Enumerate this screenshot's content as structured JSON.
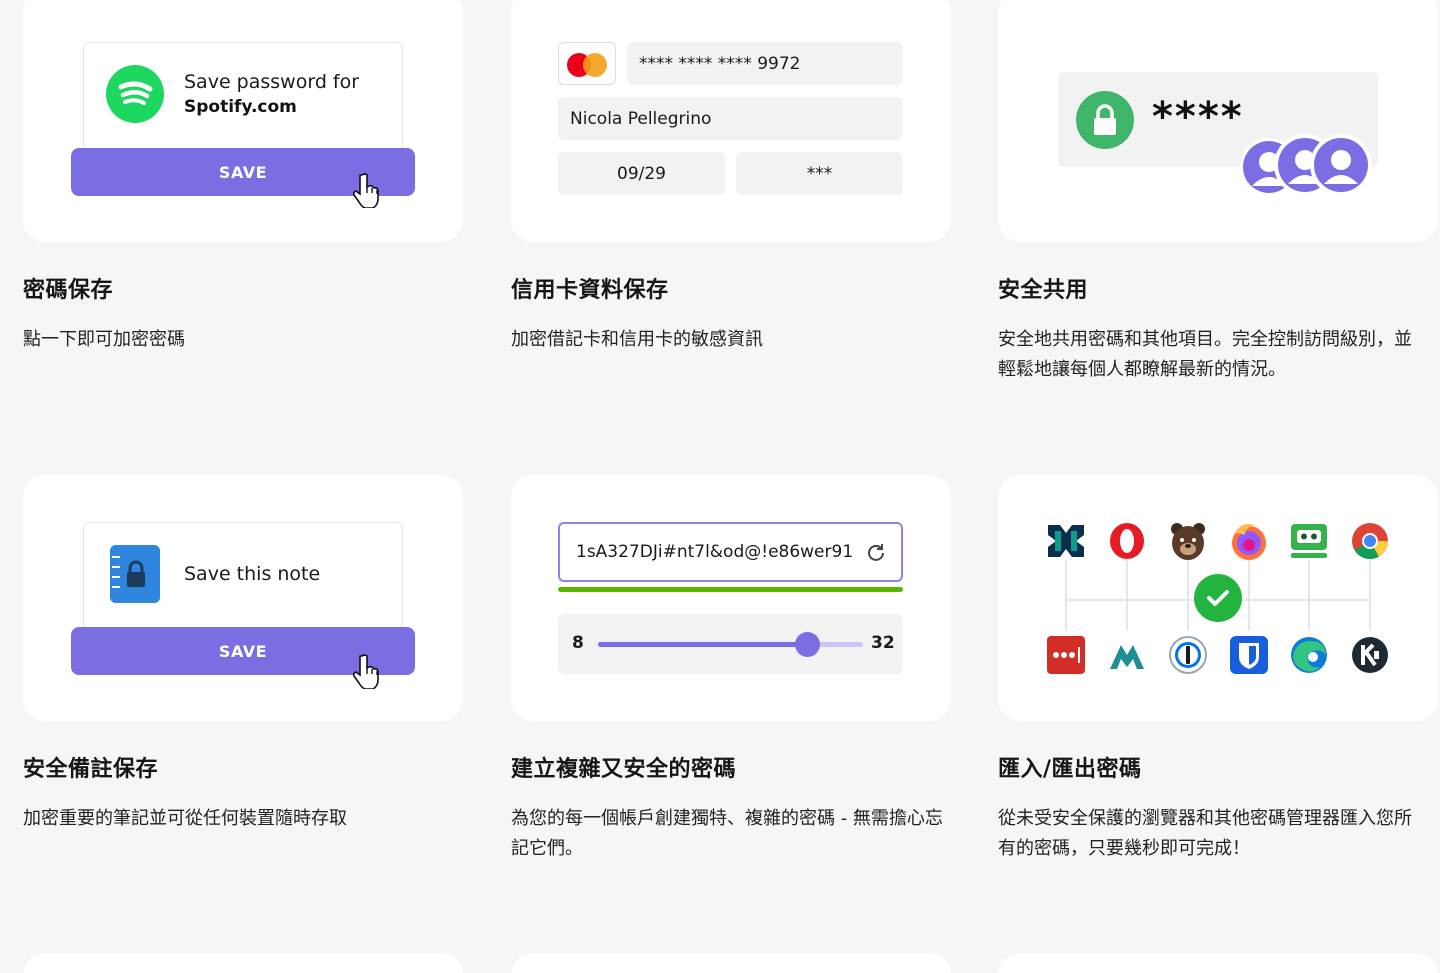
{
  "features": [
    {
      "title": "密碼保存",
      "desc": "點一下即可加密密碼"
    },
    {
      "title": "信用卡資料保存",
      "desc": "加密借記卡和信用卡的敏感資訊"
    },
    {
      "title": "安全共用",
      "desc": "安全地共用密碼和其他項目。完全控制訪問級別，並輕鬆地讓每個人都瞭解最新的情況。"
    },
    {
      "title": "安全備註保存",
      "desc": "加密重要的筆記並可從任何裝置隨時存取"
    },
    {
      "title": "建立複雜又安全的密碼",
      "desc": "為您的每一個帳戶創建獨特、複雜的密碼 - 無需擔心忘記它們。"
    },
    {
      "title": "匯入/匯出密碼",
      "desc": "從未受安全保護的瀏覽器和其他密碼管理器匯入您所有的密碼，只要幾秒即可完成！"
    }
  ],
  "password_card": {
    "line1": "Save password for",
    "line2": "Spotify.com",
    "button": "SAVE"
  },
  "credit_card": {
    "number": "**** **** **** 9972",
    "name": "Nicola Pellegrino",
    "expiry": "09/29",
    "cvv": "***"
  },
  "sharing_card": {
    "masked": "****"
  },
  "note_card": {
    "label": "Save this note",
    "button": "SAVE"
  },
  "generator_card": {
    "password": "1sA327DJi#nt7l&od@!e86wer91",
    "min": "8",
    "max": "32",
    "slider_fraction": 0.79
  },
  "colors": {
    "accent": "#7b6ee3",
    "spotify": "#1ed760",
    "lock": "#3fb66a",
    "strength": "#5bb400",
    "check": "#22b43e"
  }
}
